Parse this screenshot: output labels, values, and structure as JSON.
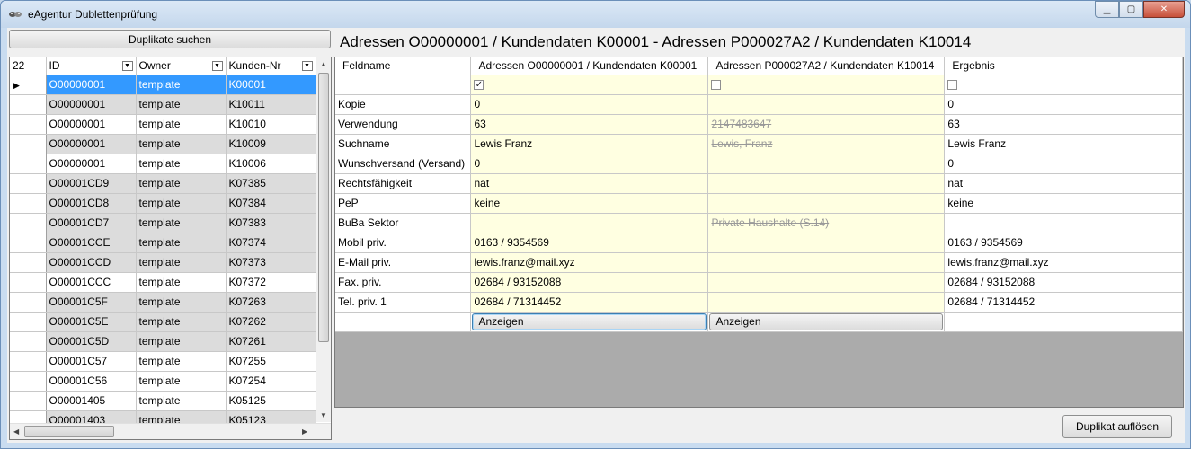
{
  "window": {
    "title": "eAgentur Dublettenprüfung",
    "buttons": {
      "minimize": "minimize-icon",
      "maximize": "maximize-icon",
      "close": "close-icon"
    }
  },
  "toolbar": {
    "search_label": "Duplikate suchen"
  },
  "heading": "Adressen O00000001 / Kundendaten K00001 - Adressen P000027A2 / Kundendaten K10014",
  "left_grid": {
    "count": "22",
    "columns": [
      "ID",
      "Owner",
      "Kunden-Nr"
    ],
    "rows": [
      [
        "O00000001",
        "template",
        "K00001"
      ],
      [
        "O00000001",
        "template",
        "K10011"
      ],
      [
        "O00000001",
        "template",
        "K10010"
      ],
      [
        "O00000001",
        "template",
        "K10009"
      ],
      [
        "O00000001",
        "template",
        "K10006"
      ],
      [
        "O00001CD9",
        "template",
        "K07385"
      ],
      [
        "O00001CD8",
        "template",
        "K07384"
      ],
      [
        "O00001CD7",
        "template",
        "K07383"
      ],
      [
        "O00001CCE",
        "template",
        "K07374"
      ],
      [
        "O00001CCD",
        "template",
        "K07373"
      ],
      [
        "O00001CCC",
        "template",
        "K07372"
      ],
      [
        "O00001C5F",
        "template",
        "K07263"
      ],
      [
        "O00001C5E",
        "template",
        "K07262"
      ],
      [
        "O00001C5D",
        "template",
        "K07261"
      ],
      [
        "O00001C57",
        "template",
        "K07255"
      ],
      [
        "O00001C56",
        "template",
        "K07254"
      ],
      [
        "O00001405",
        "template",
        "K05125"
      ],
      [
        "O00001403",
        "template",
        "K05123"
      ]
    ]
  },
  "right_grid": {
    "columns": [
      "Feldname",
      "Adressen O00000001 / Kundendaten K00001",
      "Adressen P000027A2 / Kundendaten K10014",
      "Ergebnis"
    ],
    "checkboxes": [
      true,
      false,
      false
    ],
    "rows": [
      [
        "Kopie",
        "0",
        "",
        "0"
      ],
      [
        "Verwendung",
        "63",
        "2147483647",
        "63"
      ],
      [
        "Suchname",
        "Lewis Franz",
        "Lewis, Franz",
        "Lewis Franz"
      ],
      [
        "Wunschversand (Versand)",
        "0",
        "",
        "0"
      ],
      [
        "Rechtsfähigkeit",
        "nat",
        "",
        "nat"
      ],
      [
        "PeP",
        "keine",
        "",
        "keine"
      ],
      [
        "BuBa Sektor",
        "",
        "Private Haushalte (S.14)",
        ""
      ],
      [
        "Mobil priv.",
        "0163 / 9354569",
        "",
        "0163 / 9354569"
      ],
      [
        "E-Mail priv.",
        "lewis.franz@mail.xyz",
        "",
        "lewis.franz@mail.xyz"
      ],
      [
        "Fax. priv.",
        "02684 / 93152088",
        "",
        "02684 / 93152088"
      ],
      [
        "Tel. priv. 1",
        "02684 / 71314452",
        "",
        "02684 / 71314452"
      ]
    ],
    "show_button_label": "Anzeigen"
  },
  "footer": {
    "resolve_label": "Duplikat auflösen"
  }
}
